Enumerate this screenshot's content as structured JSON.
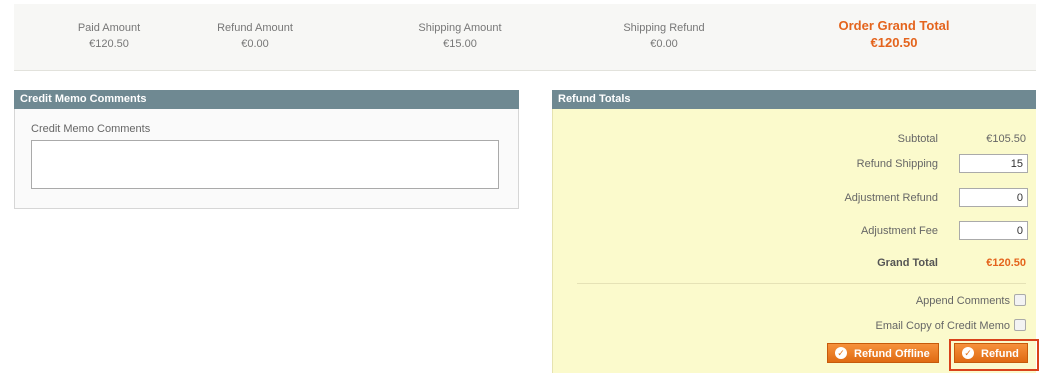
{
  "summary": {
    "paid": {
      "label": "Paid Amount",
      "value": "€120.50"
    },
    "refund": {
      "label": "Refund Amount",
      "value": "€0.00"
    },
    "shipping": {
      "label": "Shipping Amount",
      "value": "€15.00"
    },
    "shipping_refund": {
      "label": "Shipping Refund",
      "value": "€0.00"
    },
    "grand_total": {
      "label": "Order Grand Total",
      "value": "€120.50"
    }
  },
  "comments": {
    "header": "Credit Memo Comments",
    "label": "Credit Memo Comments",
    "value": ""
  },
  "totals": {
    "header": "Refund Totals",
    "subtotal": {
      "label": "Subtotal",
      "value": "€105.50"
    },
    "refund_shipping": {
      "label": "Refund Shipping",
      "value": "15"
    },
    "adjustment_refund": {
      "label": "Adjustment Refund",
      "value": "0"
    },
    "adjustment_fee": {
      "label": "Adjustment Fee",
      "value": "0"
    },
    "grand_total": {
      "label": "Grand Total",
      "value": "€120.50"
    },
    "append_comments": {
      "label": "Append Comments",
      "checked": false
    },
    "email_copy": {
      "label": "Email Copy of Credit Memo",
      "checked": false
    },
    "refund_offline_label": "Refund Offline",
    "refund_label": "Refund"
  },
  "colors": {
    "accent": "#e4641d",
    "header_bg": "#6f8992",
    "totals_bg": "#fbfacc"
  }
}
